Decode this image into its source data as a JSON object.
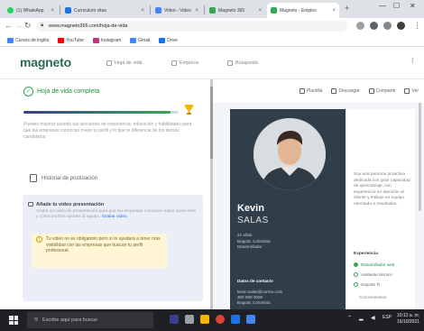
{
  "browser": {
    "tabs": [
      {
        "label": "(1) WhatsApp",
        "icon": "whatsapp-icon",
        "color": "#25d366"
      },
      {
        "label": "Curriculum vitae",
        "icon": "doc-icon",
        "color": "#1a73e8"
      },
      {
        "label": "Video - Video",
        "icon": "video-icon",
        "color": "#4285f4"
      },
      {
        "label": "Magneto 365",
        "icon": "magneto-icon",
        "color": "#34a853"
      },
      {
        "label": "Magneto - Empleo",
        "icon": "magneto-icon",
        "color": "#34a853",
        "active": true
      }
    ],
    "new_tab": "+",
    "url": "www.magneto365.com/hoja-de-vida",
    "bookmarks": [
      {
        "label": "Cursos de inglés",
        "color": "#4285f4"
      },
      {
        "label": "YouTube",
        "color": "#ff0000"
      },
      {
        "label": "Instagram",
        "color": "#c13584"
      },
      {
        "label": "Gmail",
        "color": "#4285f4"
      },
      {
        "label": "Drive",
        "color": "#1a73e8"
      }
    ]
  },
  "header": {
    "logo_text": "magneto",
    "nav": [
      "Hoja de vida",
      "Empleos",
      "Búsqueda"
    ]
  },
  "left": {
    "step_title": "Hoja de vida completa",
    "progress": 0.95,
    "description": "Puedes mejorar usando tus secciones de experiencia, educación y habilidades para que las empresas conozcan mejor tu perfil y lo que te diferencia de los demás candidatos.",
    "history_label": "Historial de postulación",
    "video_card": {
      "title": "Añade tu video presentación",
      "description": "Graba un video de presentación para que las empresas conozcan mejor quién eres y cómo podrías aportar al equipo.",
      "link": "Grabar video"
    },
    "alert": "Tu video no es obligatorio pero sí te ayudará a tener más visibilidad con las empresas que buscan tu perfil profesional."
  },
  "right": {
    "tabs": [
      "Plantilla",
      "Descargar",
      "Compartir",
      "Ver"
    ],
    "cv": {
      "first_name": "Kevin",
      "last_name": "SALAS",
      "info": [
        "21 años",
        "Bogotá, Colombia",
        "Desarrollador"
      ],
      "section_head": "Datos de contacto",
      "contact": [
        "kevin.salas@correo.com",
        "300 000 0000",
        "Bogotá, Colombia"
      ],
      "intro": "Soy una persona proactiva dedicada con gran capacidad de aprendizaje, con experiencia en atención al cliente y trabajo en equipo orientado a resultados.",
      "experience_head": "Experiencia",
      "experience": [
        {
          "label": "Desarrollador web",
          "highlight": true
        },
        {
          "label": "Asistente técnico",
          "highlight": false
        },
        {
          "label": "Soporte TI",
          "highlight": false
        }
      ],
      "exp_text": "Conocimientos"
    }
  },
  "taskbar": {
    "search_placeholder": "Escribe aquí para buscar",
    "time": "10:12 a. m.",
    "date": "16/10/2021"
  }
}
